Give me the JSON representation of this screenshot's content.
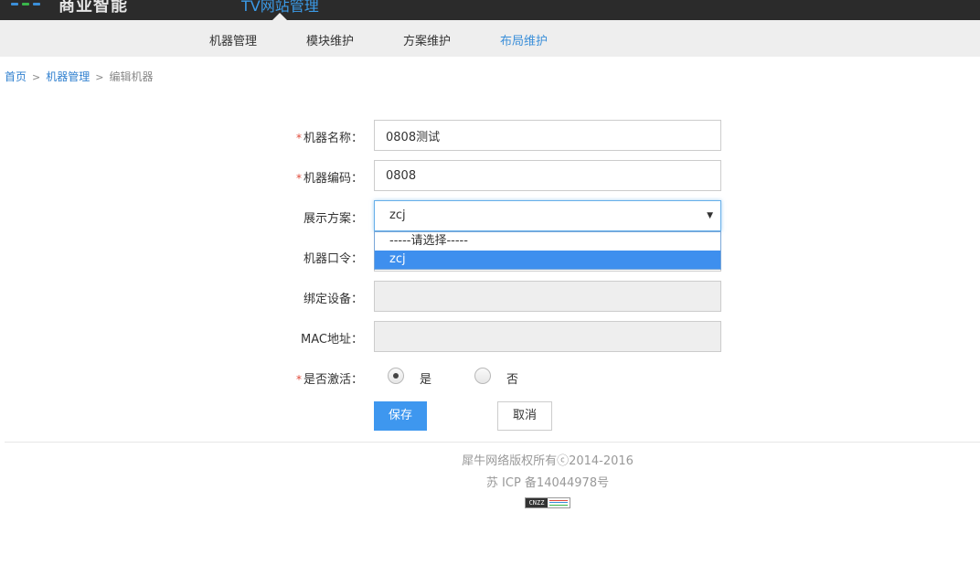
{
  "header": {
    "brand": "商业智能",
    "site_title": "TV网站管理",
    "logo_colors": [
      "#3b8fd9",
      "#39b54a",
      "#3b8fd9"
    ]
  },
  "nav": {
    "items": [
      {
        "label": "机器管理",
        "active": false
      },
      {
        "label": "模块维护",
        "active": false
      },
      {
        "label": "方案维护",
        "active": false
      },
      {
        "label": "布局维护",
        "active": true
      }
    ]
  },
  "breadcrumb": {
    "home": "首页",
    "sep": ">",
    "parent": "机器管理",
    "current": "编辑机器"
  },
  "form": {
    "required_mark": "*",
    "name": {
      "label": "机器名称：",
      "value": "0808测试"
    },
    "code": {
      "label": "机器编码：",
      "value": "0808"
    },
    "scheme": {
      "label": "展示方案：",
      "value": "zcj",
      "options": [
        "-----请选择-----",
        "zcj"
      ],
      "selected_index": 1
    },
    "password": {
      "label": "机器口令："
    },
    "device": {
      "label": "绑定设备：",
      "value": ""
    },
    "mac": {
      "label": "MAC地址：",
      "value": ""
    },
    "active": {
      "label": "是否激活：",
      "yes": "是",
      "no": "否",
      "checked": "yes"
    },
    "save_label": "保存",
    "cancel_label": "取消"
  },
  "footer": {
    "copyright": "犀牛网络版权所有ⓒ2014-2016",
    "icp": "苏 ICP 备14044978号",
    "badge_text": "CNZZ"
  },
  "colors": {
    "accent": "#3e97ef",
    "nav_active": "#3b8fd9",
    "required": "#e04a3a"
  }
}
